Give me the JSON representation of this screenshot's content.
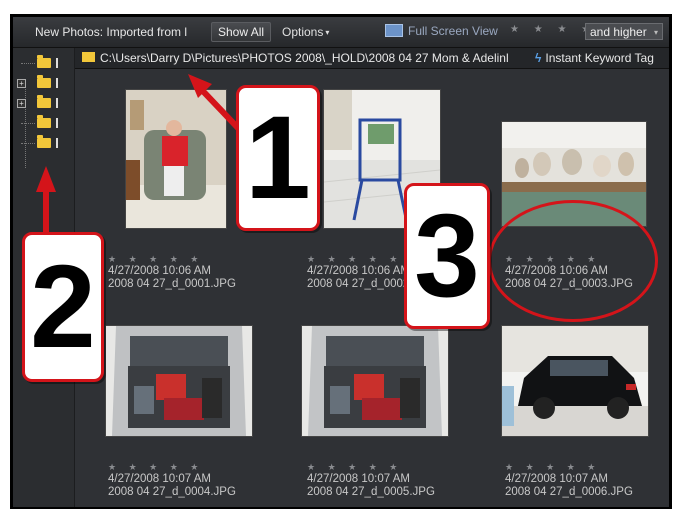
{
  "toolbar": {
    "title": "New Photos: Imported from l",
    "show_all": "Show All",
    "options": "Options",
    "options_caret": "▾",
    "full_screen": "Full Screen View",
    "star_filter": "★ ★ ★ ★ ★",
    "rating_select": "and higher",
    "select_caret": "▾"
  },
  "pathbar": {
    "path": "C:\\Users\\Darry D\\Pictures\\PHOTOS 2008\\_HOLD\\2008 04 27 Mom & Adelinl",
    "keyword_tag": "Instant Keyword Tag",
    "keyword_icon": "lightning-icon"
  },
  "tree": {
    "rows": [
      {
        "expander": ""
      },
      {
        "expander": "+"
      },
      {
        "expander": "+"
      },
      {
        "expander": ""
      },
      {
        "expander": ""
      }
    ]
  },
  "photos": [
    {
      "stars": "★ ★ ★ ★ ★",
      "date": "4/27/2008 10:06 AM",
      "name": "2008 04 27_d_0001.JPG"
    },
    {
      "stars": "★ ★ ★ ★ ★",
      "date": "4/27/2008 10:06 AM",
      "name": "2008 04 27_d_0002.JPG"
    },
    {
      "stars": "★ ★ ★ ★ ★",
      "date": "4/27/2008 10:06 AM",
      "name": "2008 04 27_d_0003.JPG"
    },
    {
      "stars": "★ ★ ★ ★ ★",
      "date": "4/27/2008 10:07 AM",
      "name": "2008 04 27_d_0004.JPG"
    },
    {
      "stars": "★ ★ ★ ★ ★",
      "date": "4/27/2008 10:07 AM",
      "name": "2008 04 27_d_0005.JPG"
    },
    {
      "stars": "★ ★ ★ ★ ★",
      "date": "4/27/2008 10:07 AM",
      "name": "2008 04 27_d_0006.JPG"
    }
  ],
  "callouts": {
    "one": "1",
    "two": "2",
    "three": "3"
  },
  "colors": {
    "callout_border": "#d4141a",
    "folder": "#f2c73a",
    "panel_bg": "#2f3135"
  }
}
